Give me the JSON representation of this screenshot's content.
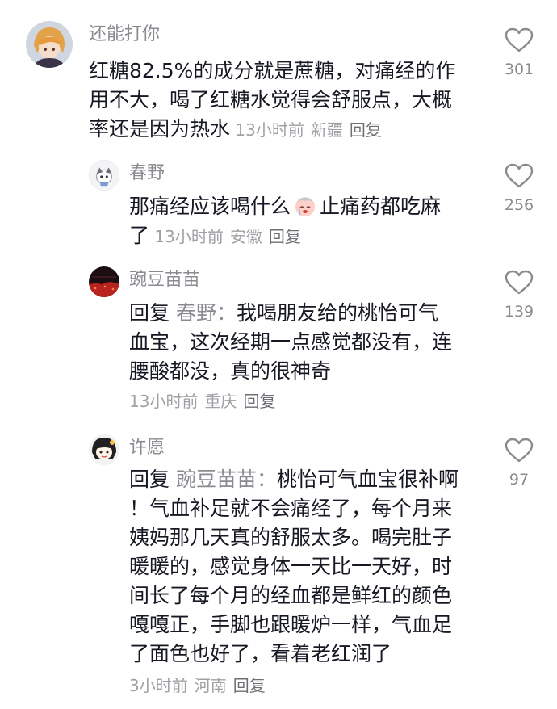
{
  "comments": [
    {
      "username": "还能打你",
      "lines": [
        "红糖82.5%的成分就是蔗糖，对痛经的作",
        "用不大，喝了红糖水觉得会舒服点，大概",
        "率还是因为热水"
      ],
      "time": "13小时前",
      "location": "新疆",
      "reply_label": "回复",
      "likes": "301",
      "avatar_icon": "anime-girl-avatar"
    },
    {
      "username": "春野",
      "line1_before": "那痛经应该喝什么",
      "line1_after": "止痛药都吃麻",
      "line2": "了",
      "emoji_icon": "crying-face-emoji",
      "time": "13小时前",
      "location": "安徽",
      "reply_label": "回复",
      "likes": "256",
      "avatar_icon": "cartoon-avatar"
    },
    {
      "username": "豌豆苗苗",
      "reply_prefix": "回复",
      "reply_target": "春野：",
      "line1": "我喝朋友给的桃怡可气",
      "line2": "血宝，这次经期一点感觉都没有，连",
      "line3": "腰酸都没，真的很神奇",
      "time": "13小时前",
      "location": "重庆",
      "reply_label": "回复",
      "likes": "139",
      "avatar_icon": "red-scene-avatar"
    },
    {
      "username": "许愿",
      "reply_prefix": "回复",
      "reply_target": "豌豆苗苗：",
      "line1": "桃怡可气血宝很补啊",
      "lines_rest": [
        "！气血补足就不会痛经了，每个月来",
        "姨妈那几天真的舒服太多。喝完肚子",
        "暖暖的，感觉身体一天比一天好，时",
        "间长了每个月的经血都是鲜红的颜色",
        "嘎嘎正，手脚也跟暖炉一样，气血足",
        "了面色也好了，看着老红润了"
      ],
      "time": "3小时前",
      "location": "河南",
      "reply_label": "回复",
      "likes": "97",
      "avatar_icon": "cartoon-girl-avatar"
    }
  ],
  "like_icon": "heart-outline-icon",
  "colors": {
    "text": "#161823",
    "secondary": "#8a8b91",
    "meta": "#a0a1a6"
  }
}
